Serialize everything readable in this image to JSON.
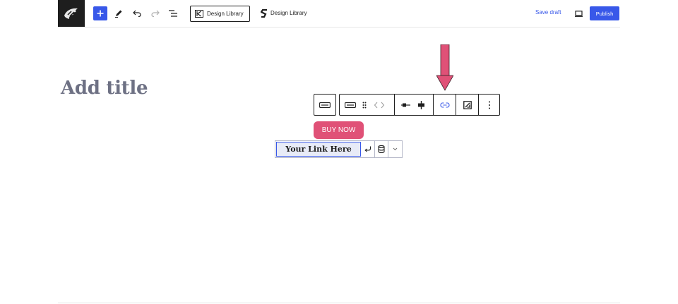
{
  "topbar": {
    "add_block_icon": "plus-icon",
    "tools_icon": "pencil-icon",
    "undo_icon": "undo-icon",
    "redo_icon": "redo-icon",
    "outline_icon": "list-view-icon",
    "library_k_label": "Design Library",
    "library_s_label": "Design Library",
    "save_draft_label": "Save draft",
    "preview_icon": "desktop-icon",
    "publish_label": "Publish"
  },
  "editor": {
    "title_placeholder": "Add title"
  },
  "button_block": {
    "label": "BUY NOW",
    "color": "#e05177"
  },
  "link_control": {
    "value": "Your Link Here",
    "submit_icon": "enter-icon",
    "dynamic_icon": "database-icon",
    "options_icon": "chevron-down-icon"
  },
  "colors": {
    "accent": "#3858e9",
    "arrow": "#e05177"
  }
}
